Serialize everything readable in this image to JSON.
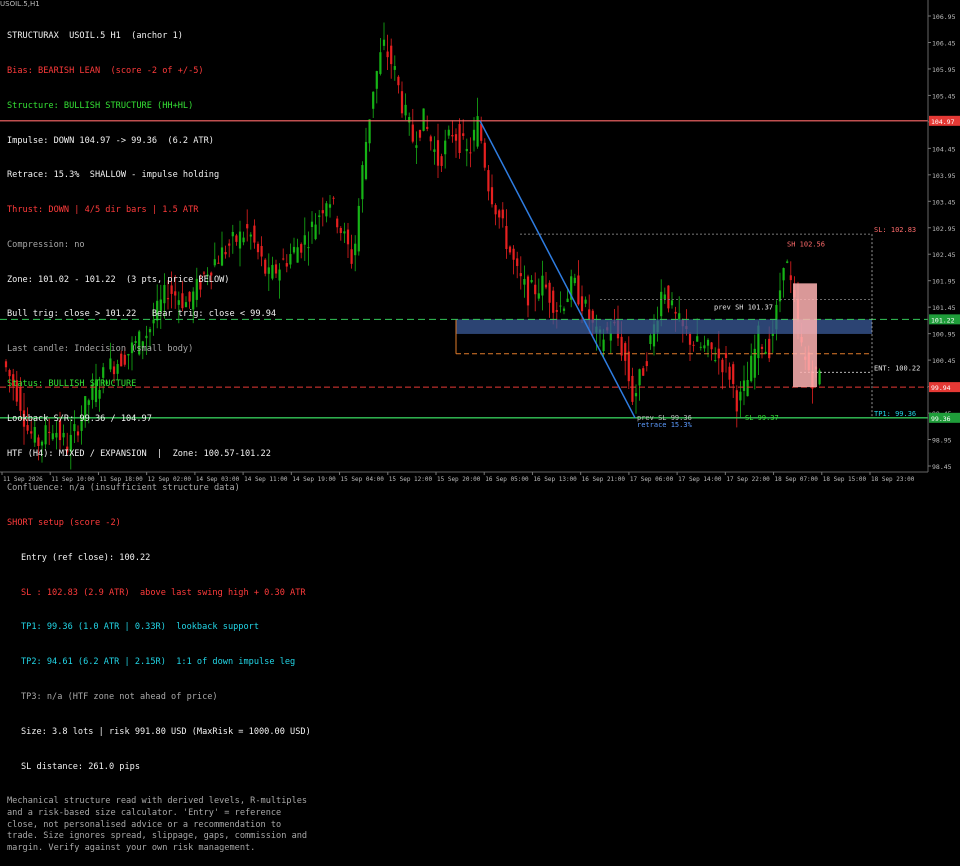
{
  "window_tab": "USOIL.5,H1",
  "panel": {
    "header": "STRUCTURAX  USOIL.5 H1  (anchor 1)",
    "bias": "Bias: BEARISH LEAN  (score -2 of +/-5)",
    "structure": "Structure: BULLISH STRUCTURE (HH+HL)",
    "impulse": "Impulse: DOWN 104.97 -> 99.36  (6.2 ATR)",
    "retrace": "Retrace: 15.3%  SHALLOW - impulse holding",
    "thrust": "Thrust: DOWN | 4/5 dir bars | 1.5 ATR",
    "compression": "Compression: no",
    "zone": "Zone: 101.02 - 101.22  (3 pts, price BELOW)",
    "triggers": "Bull trig: close > 101.22   Bear trig: close < 99.94",
    "last_candle": "Last candle: Indecision (small body)",
    "status": "Status: BULLISH STRUCTURE",
    "lookback": "Lookback S/R: 99.36 / 104.97",
    "htf": "HTF (H4): MIXED / EXPANSION  |  Zone: 100.57-101.22",
    "confluence": "Confluence: n/a (insufficient structure data)",
    "setup": "SHORT setup (score -2)",
    "entry": "Entry (ref close): 100.22",
    "sl": "SL : 102.83 (2.9 ATR)  above last swing high + 0.30 ATR",
    "tp1": "TP1: 99.36 (1.0 ATR | 0.33R)  lookback support",
    "tp2": "TP2: 94.61 (6.2 ATR | 2.15R)  1:1 of down impulse leg",
    "tp3": "TP3: n/a (HTF zone not ahead of price)",
    "size": "Size: 3.8 lots | risk 991.80 USD (MaxRisk = 1000.00 USD)",
    "sl_distance": "SL distance: 261.0 pips",
    "disclaimer": "Mechanical structure read with derived levels, R-multiples and a risk-based size calculator. 'Entry' = reference close, not personalised advice or a recommendation to trade. Size ignores spread, slippage, gaps, commission and margin. Verify against your own risk management."
  },
  "chart_labels": {
    "sl_line": "SL: 102.83",
    "sh": "SH 102.56",
    "prev_sh": "prev SH 101.37",
    "entry": "ENT: 100.22",
    "prev_sl": "prev SL 99.36",
    "retrace": "retrace 15.3%",
    "sl2": "SL 99.37",
    "tp1": "TP1: 99.36"
  },
  "price_axis": {
    "ticks": [
      "106.95",
      "106.45",
      "105.95",
      "105.45",
      "104.95",
      "104.45",
      "103.95",
      "103.45",
      "102.95",
      "102.45",
      "101.95",
      "101.45",
      "100.95",
      "100.45",
      "99.95",
      "99.45",
      "98.95",
      "98.45"
    ],
    "tags": [
      {
        "text": "104.97",
        "price": 104.97,
        "color": "#e53935"
      },
      {
        "text": "101.22",
        "price": 101.22,
        "color": "#1f9d3a"
      },
      {
        "text": "99.94",
        "price": 99.94,
        "color": "#e53935"
      },
      {
        "text": "99.36",
        "price": 99.36,
        "color": "#1f9d3a"
      }
    ]
  },
  "time_axis": [
    "11 Sep 2026",
    "11 Sep 10:00",
    "11 Sep 18:00",
    "12 Sep 02:00",
    "14 Sep 03:00",
    "14 Sep 11:00",
    "14 Sep 19:00",
    "15 Sep 04:00",
    "15 Sep 12:00",
    "15 Sep 20:00",
    "16 Sep 05:00",
    "16 Sep 13:00",
    "16 Sep 21:00",
    "17 Sep 06:00",
    "17 Sep 14:00",
    "17 Sep 22:00",
    "18 Sep 07:00",
    "18 Sep 15:00",
    "18 Sep 23:00"
  ],
  "colors": {
    "bull": "#16b316",
    "bear": "#e62020",
    "resistance": "#ff6b6b",
    "support": "#34c759",
    "impulse": "#2f7de1",
    "zone": "#3b5b9a",
    "sl_box": "#ffb3b3"
  }
}
